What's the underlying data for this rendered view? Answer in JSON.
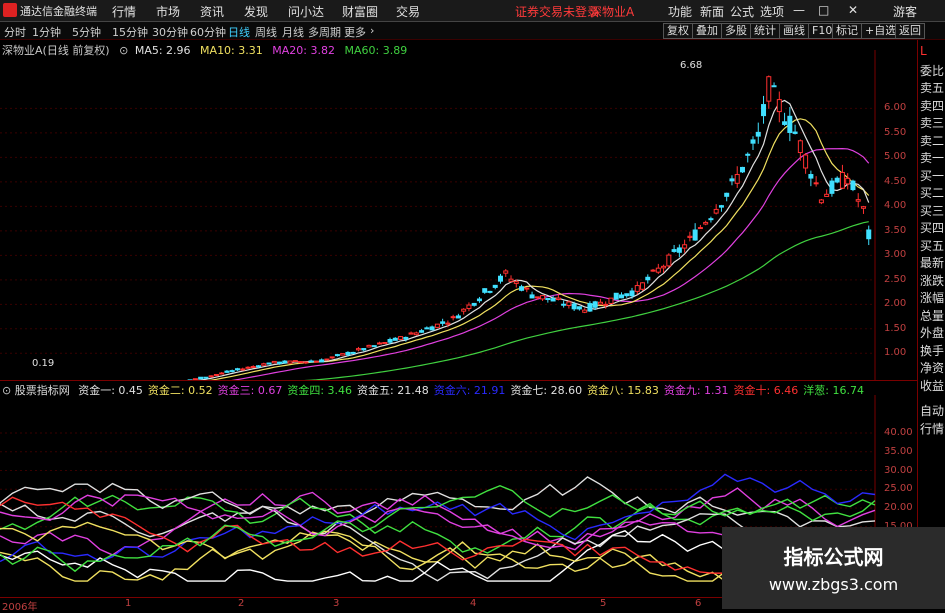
{
  "menu": {
    "app_title": "通达信金融终端",
    "items": [
      "行情",
      "市场",
      "资讯",
      "发现",
      "问小达",
      "财富圈",
      "交易"
    ],
    "alert": "证券交易未登录",
    "stock_link": "深物业A",
    "right_items": [
      "功能",
      "新面",
      "公式",
      "选项"
    ],
    "guest": "游客"
  },
  "toolbar": {
    "periods": [
      "分时",
      "1分钟",
      "5分钟",
      "15分钟",
      "30分钟",
      "60分钟",
      "日线",
      "周线",
      "月线",
      "多周期",
      "更多"
    ],
    "active_period": "日线",
    "buttons": [
      "复权",
      "叠加",
      "多股",
      "统计",
      "画线",
      "F10",
      "标记",
      "+自选",
      "返回"
    ]
  },
  "main_chart": {
    "title": "深物业A(日线 前复权)",
    "ma": [
      {
        "label": "MA5: 2.96",
        "color": "#e0e0e0"
      },
      {
        "label": "MA10: 3.31",
        "color": "#f0e060"
      },
      {
        "label": "MA20: 3.82",
        "color": "#e040e0"
      },
      {
        "label": "MA60: 3.89",
        "color": "#40d040"
      }
    ],
    "high_label": "6.68",
    "low_label": "0.19"
  },
  "sub_chart": {
    "title": "股票指标网",
    "items": [
      {
        "label": "资金一: 0.45",
        "color": "#e0e0e0"
      },
      {
        "label": "资金二: 0.52",
        "color": "#f0e060"
      },
      {
        "label": "资金三: 0.67",
        "color": "#e040e0"
      },
      {
        "label": "资金四: 3.46",
        "color": "#40e040"
      },
      {
        "label": "资金五: 21.48",
        "color": "#e0e0e0"
      },
      {
        "label": "资金六: 21.91",
        "color": "#2a2aff"
      },
      {
        "label": "资金七: 28.60",
        "color": "#e0e0e0"
      },
      {
        "label": "资金八: 15.83",
        "color": "#f0e060"
      },
      {
        "label": "资金九: 1.31",
        "color": "#e040e0"
      },
      {
        "label": "资金十: 6.46",
        "color": "#ff3030"
      },
      {
        "label": "洋葱: 16.74",
        "color": "#40e040"
      }
    ]
  },
  "right_panel": [
    "L",
    "委比",
    "卖五",
    "卖四",
    "卖三",
    "卖二",
    "卖一",
    "买一",
    "买二",
    "买三",
    "买四",
    "买五",
    "最新",
    "涨跌",
    "涨幅",
    "总量",
    "外盘",
    "换手",
    "净资",
    "收益",
    "自动",
    "行情"
  ],
  "price_axis": [
    "6.00",
    "5.50",
    "5.00",
    "4.50",
    "4.00",
    "3.50",
    "3.00",
    "2.50",
    "2.00",
    "1.50",
    "1.00"
  ],
  "sub_axis": [
    "40.00",
    "35.00",
    "30.00",
    "25.00",
    "20.00",
    "15.00"
  ],
  "date_axis": [
    "2006年",
    "1",
    "2",
    "3",
    "4",
    "5",
    "6"
  ],
  "watermark": {
    "line1": "指标公式网",
    "line2": "www.zbgs3.com"
  }
}
